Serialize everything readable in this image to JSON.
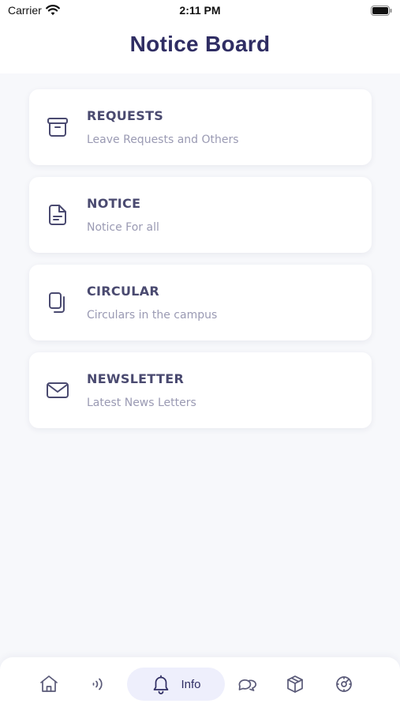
{
  "status_bar": {
    "carrier": "Carrier",
    "time": "2:11 PM"
  },
  "header": {
    "title": "Notice Board"
  },
  "menu": {
    "items": [
      {
        "title": "REQUESTS",
        "subtitle": "Leave Requests and Others",
        "icon": "archive-icon"
      },
      {
        "title": "NOTICE",
        "subtitle": "Notice For all",
        "icon": "document-icon"
      },
      {
        "title": "CIRCULAR",
        "subtitle": "Circulars in the campus",
        "icon": "copy-icon"
      },
      {
        "title": "NEWSLETTER",
        "subtitle": "Latest News Letters",
        "icon": "mail-icon"
      }
    ]
  },
  "bottom_nav": {
    "items": [
      {
        "icon": "home-icon"
      },
      {
        "icon": "wireless-icon"
      },
      {
        "icon": "bell-icon",
        "label": "Info",
        "active": true
      },
      {
        "icon": "chat-icon"
      },
      {
        "icon": "cube-icon"
      },
      {
        "icon": "settings-icon"
      }
    ]
  },
  "colors": {
    "title": "#2f2d63",
    "card_title": "#4a4a70",
    "card_subtitle": "#9a9ab3",
    "icon_stroke": "#4a4a70",
    "active_pill": "#eeeffc",
    "background": "#f7f8fb"
  }
}
